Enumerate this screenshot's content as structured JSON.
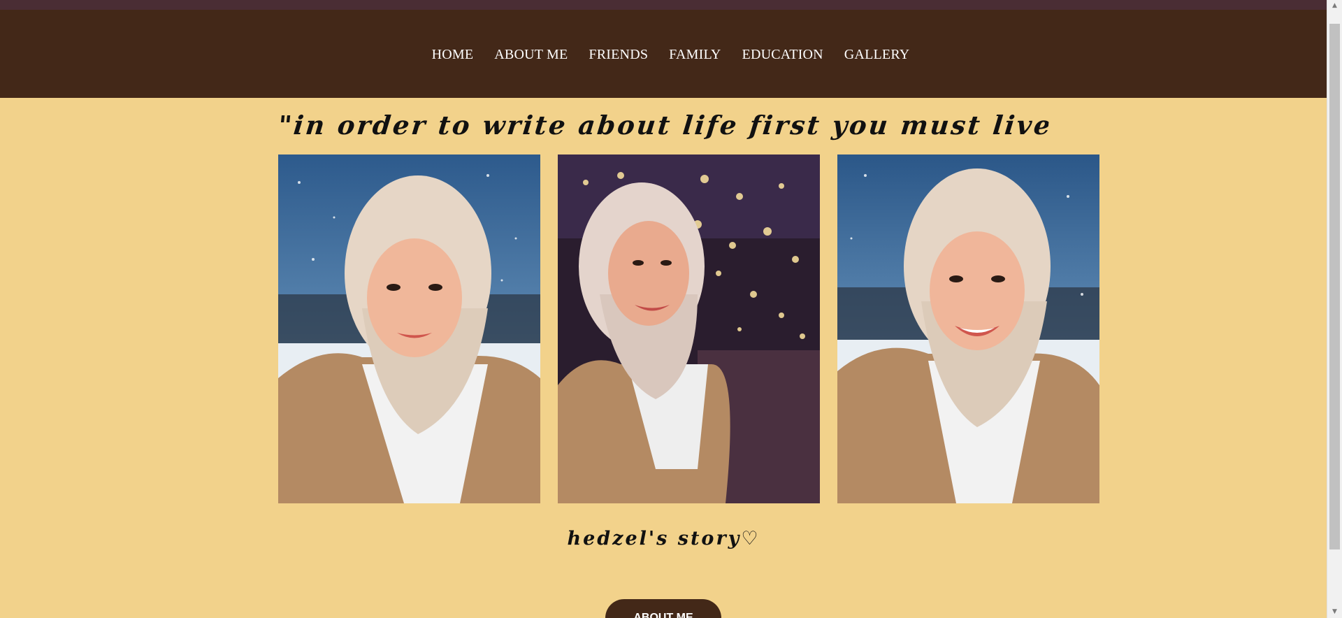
{
  "nav": {
    "items": [
      {
        "label": "HOME"
      },
      {
        "label": "ABOUT ME"
      },
      {
        "label": "FRIENDS"
      },
      {
        "label": "FAMILY"
      },
      {
        "label": "EDUCATION"
      },
      {
        "label": "GALLERY"
      }
    ]
  },
  "hero": {
    "quote": "\"in order to write about life first you must live it\""
  },
  "gallery": {
    "photos": [
      {
        "icon": "portrait-photo"
      },
      {
        "icon": "portrait-photo"
      },
      {
        "icon": "portrait-photo"
      }
    ]
  },
  "story": {
    "title": "hedzel's story♡"
  },
  "cta": {
    "label": "ABOUT ME"
  },
  "colors": {
    "background": "#f2d28b",
    "navbar": "#432818",
    "top_strip": "#4a2d34",
    "button": "#432818"
  },
  "scrollbar": {
    "up_icon": "chevron-up-icon",
    "down_icon": "chevron-down-icon"
  }
}
